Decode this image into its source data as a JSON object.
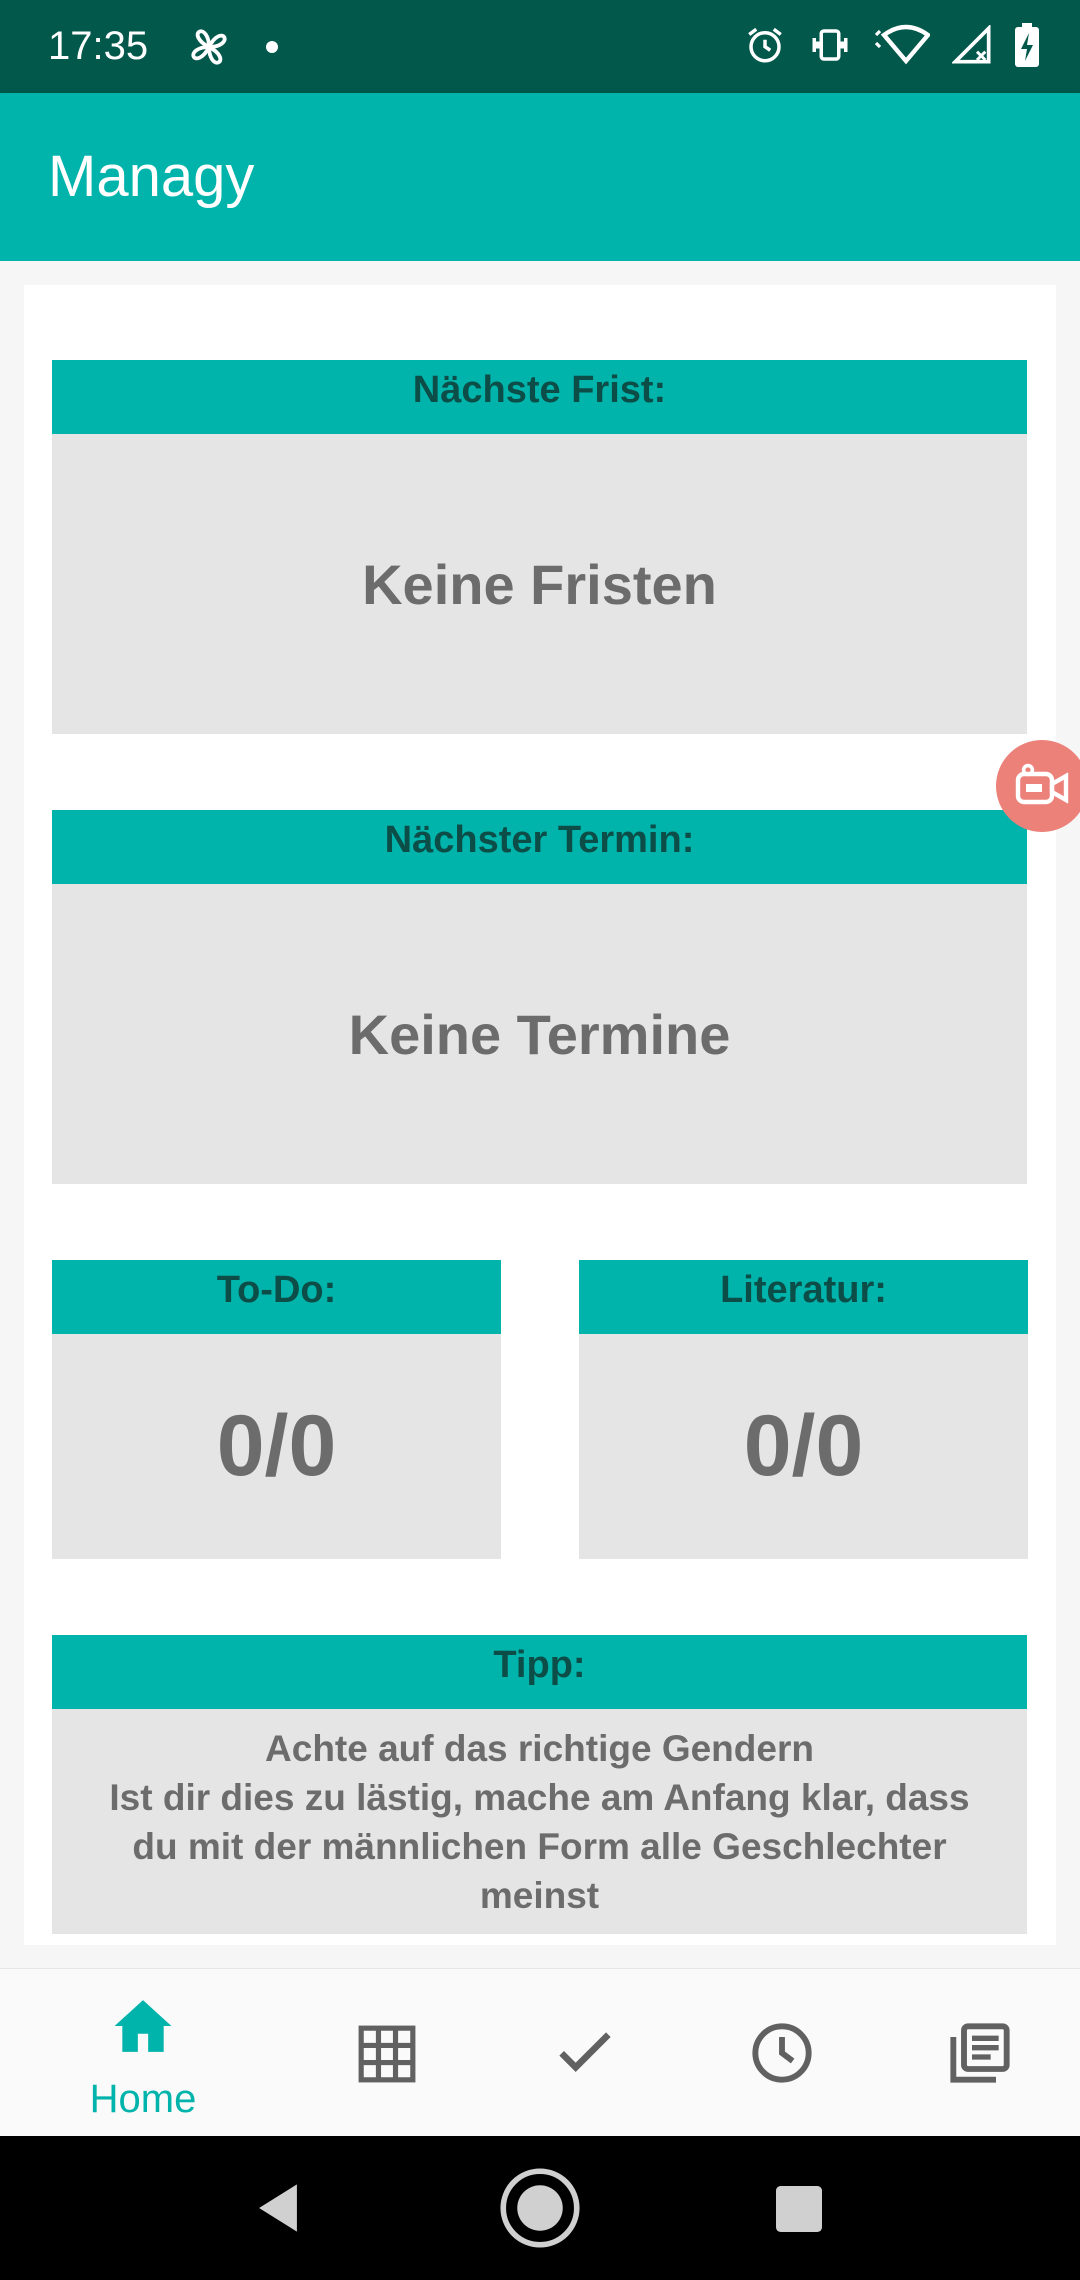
{
  "status_bar": {
    "time": "17:35",
    "icons": [
      "pinwheel-icon",
      "dot-icon",
      "alarm-icon",
      "vibrate-icon",
      "wifi-icon",
      "signal-icon",
      "battery-icon"
    ]
  },
  "app_bar": {
    "title": "Managy"
  },
  "cards": {
    "deadline": {
      "header": "Nächste Frist:",
      "value": "Keine Fristen"
    },
    "appointment": {
      "header": "Nächster Termin:",
      "value": "Keine Termine"
    },
    "todo": {
      "header": "To-Do:",
      "value": "0/0"
    },
    "literature": {
      "header": "Literatur:",
      "value": "0/0"
    },
    "tip": {
      "header": "Tipp:",
      "lines": [
        "Achte auf das richtige Gendern",
        "Ist dir dies zu lästig, mache am Anfang klar, dass",
        "du mit der männlichen Form alle Geschlechter",
        "meinst"
      ]
    }
  },
  "bottom_nav": {
    "items": [
      {
        "icon": "home-icon",
        "label": "Home",
        "selected": true
      },
      {
        "icon": "grid-icon",
        "label": ""
      },
      {
        "icon": "check-icon",
        "label": ""
      },
      {
        "icon": "clock-icon",
        "label": ""
      },
      {
        "icon": "library-icon",
        "label": ""
      }
    ]
  },
  "colors": {
    "status_bar": "#01584b",
    "primary": "#00b3ab",
    "header_text": "#0c4d47",
    "panel_bg": "#e5e5e5",
    "panel_text": "#6c6c6c",
    "fab": "#ec8179",
    "nav_inactive": "#616161"
  }
}
